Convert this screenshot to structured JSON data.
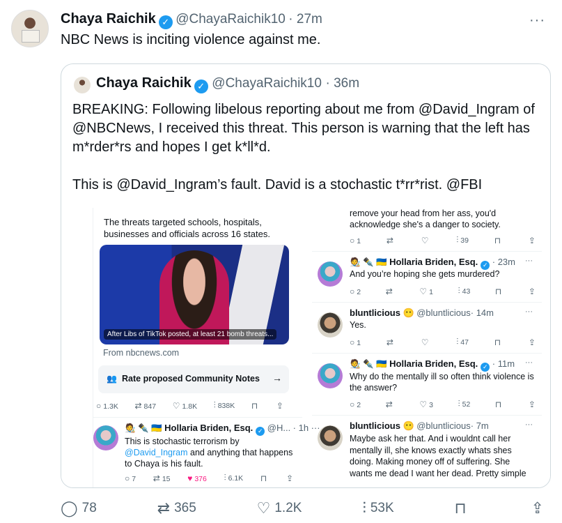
{
  "tweet": {
    "name": "Chaya Raichik",
    "handle": "@ChayaRaichik10",
    "time": "· 27m",
    "text": "NBC News is inciting violence against me.",
    "more": "···"
  },
  "quote": {
    "name": "Chaya Raichik",
    "handle": "@ChayaRaichik10",
    "time": "· 36m",
    "paragraph1": "BREAKING: Following libelous reporting about me from @David_Ingram of @NBCNews, I received this threat. This person is warning that the left has m*rder*rs and hopes I get k*ll*d.",
    "paragraph2": "This is @David_Ingram’s fault. David is a stochastic t*rr*rist. @FBI"
  },
  "screenshot": {
    "left": {
      "article_summary": "The threats targeted schools, hospitals, businesses and officials across 16 states.",
      "image_caption": "After Libs of TikTok posted, at least 21 bomb threats...",
      "source": "From nbcnews.com",
      "community_notes": "Rate proposed Community Notes",
      "community_arrow": "→",
      "stats": {
        "replies": "1.3K",
        "reposts": "847",
        "likes": "1.8K",
        "views": "838K"
      },
      "reply": {
        "emoji": "🧑‍🎨 ✒️ 🇺🇦",
        "name": "Hollaria Briden, Esq.",
        "handle": "@H...",
        "time": "· 1h",
        "more": "···",
        "text_before": "This is stochastic terrorism by",
        "mention": "@David_Ingram",
        "text_after": " and anything that happens to Chaya is his fault.",
        "stats": {
          "replies": "7",
          "reposts": "15",
          "likes": "376",
          "views": "6.1K"
        }
      }
    },
    "right": {
      "top_text": "remove your head from her ass, you'd acknowledge she's a danger to society.",
      "top_stats": {
        "replies": "1",
        "reposts": "",
        "likes": "",
        "views": "39"
      },
      "replies": [
        {
          "emoji": "🧑‍🎨 ✒️ 🇺🇦",
          "name": "Hollaria Briden, Esq.",
          "handle": "",
          "time": "· 23m",
          "text": "And you’re hoping she gets murdered?",
          "stats": {
            "replies": "2",
            "reposts": "",
            "likes": "1",
            "views": "43"
          }
        },
        {
          "emoji": "",
          "name": "bluntlicious 😶",
          "handle": "@bluntlicious",
          "time": "· 14m",
          "text": "Yes.",
          "stats": {
            "replies": "1",
            "reposts": "",
            "likes": "",
            "views": "47"
          }
        },
        {
          "emoji": "🧑‍🎨 ✒️ 🇺🇦",
          "name": "Hollaria Briden, Esq.",
          "handle": "",
          "time": "· 11m",
          "text": "Why do the mentally ill so often think violence is the answer?",
          "stats": {
            "replies": "2",
            "reposts": "",
            "likes": "3",
            "views": "52"
          }
        },
        {
          "emoji": "",
          "name": "bluntlicious 😶",
          "handle": "@bluntlicious",
          "time": "· 7m",
          "text": "Maybe ask her that. And i wouldnt call her mentally ill, she knows exactly whats shes doing. Making money off of suffering. She wants me dead I want her dead. Pretty simple",
          "stats": {}
        }
      ]
    }
  },
  "actions": {
    "replies": "78",
    "reposts": "365",
    "likes": "1.2K",
    "views": "53K"
  },
  "colors": {
    "verified": "#1d9bf0",
    "link": "#1d9bf0",
    "like": "#f91880",
    "text": "#0f1419",
    "muted": "#536471"
  },
  "icons": [
    "reply-icon",
    "repost-icon",
    "like-icon",
    "views-icon",
    "bookmark-icon",
    "share-icon",
    "verified-icon",
    "more-icon"
  ]
}
